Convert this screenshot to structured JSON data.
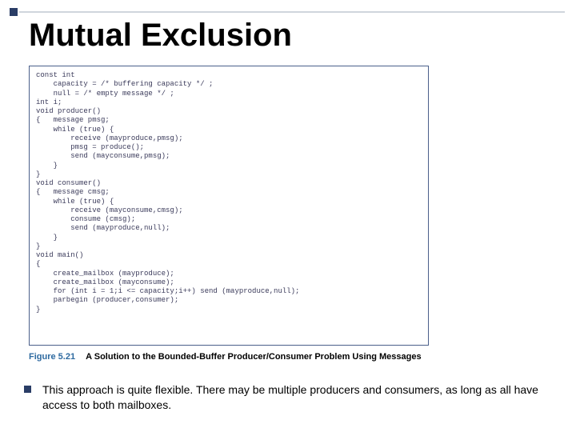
{
  "title": "Mutual Exclusion",
  "code": "const int\n    capacity = /* buffering capacity */ ;\n    null = /* empty message */ ;\nint i;\nvoid producer()\n{   message pmsg;\n    while (true) {\n        receive (mayproduce,pmsg);\n        pmsg = produce();\n        send (mayconsume,pmsg);\n    }\n}\nvoid consumer()\n{   message cmsg;\n    while (true) {\n        receive (mayconsume,cmsg);\n        consume (cmsg);\n        send (mayproduce,null);\n    }\n}\nvoid main()\n{\n    create_mailbox (mayproduce);\n    create_mailbox (mayconsume);\n    for (int i = 1;i <= capacity;i++) send (mayproduce,null);\n    parbegin (producer,consumer);\n}",
  "caption": {
    "figure_label": "Figure 5.21",
    "text": "A Solution to the Bounded-Buffer Producer/Consumer Problem Using Messages"
  },
  "bullet": "This approach is quite flexible. There may be multiple producers and consumers, as long as all have access to both mailboxes."
}
